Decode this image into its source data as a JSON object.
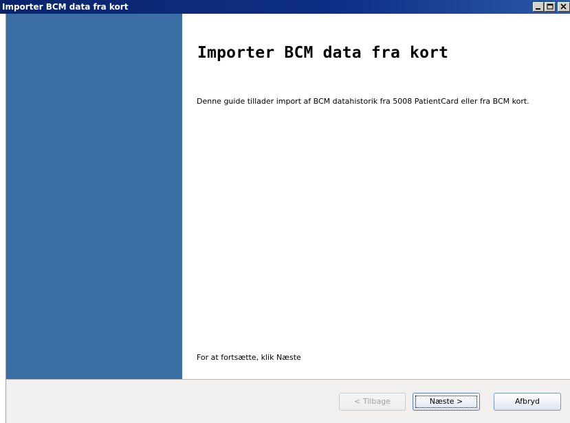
{
  "window": {
    "title": "Importer BCM data fra kort",
    "controls": {
      "minimize_icon": "minimize-icon",
      "maximize_icon": "maximize-icon",
      "close_icon": "close-icon"
    }
  },
  "main": {
    "heading": "Importer BCM data fra kort",
    "description": "Denne guide tillader import af BCM datahistorik fra 5008 PatientCard eller fra BCM kort.",
    "continue_hint": "For at fortsætte, klik Næste"
  },
  "footer": {
    "back_label": "< Tilbage",
    "next_label": "Næste >",
    "cancel_label": "Afbryd",
    "back_enabled": false
  },
  "colors": {
    "titlebar": "#0a246a",
    "sidebar": "#3a6ea5",
    "footer": "#f1f0ee"
  }
}
